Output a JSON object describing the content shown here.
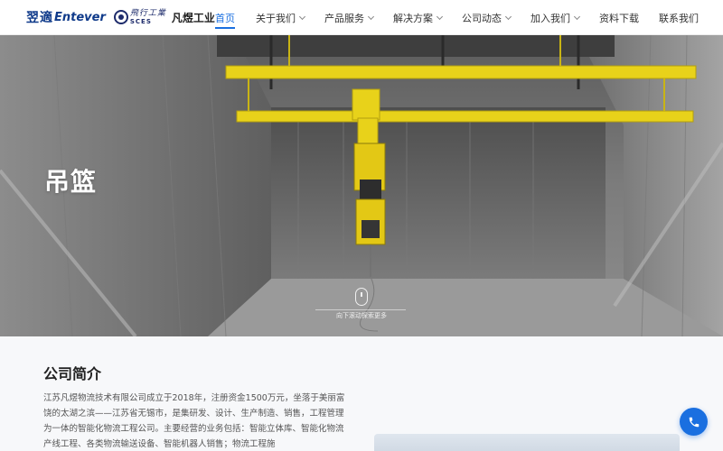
{
  "brand": {
    "logo_yt": "翌適",
    "logo_entever": "Entever",
    "logo_sces_cn": "飛行工業",
    "logo_sces_en": "SCES",
    "company_short": "凡煜工业"
  },
  "nav": {
    "items": [
      {
        "label": "首页",
        "active": true,
        "dropdown": false
      },
      {
        "label": "关于我们",
        "active": false,
        "dropdown": true
      },
      {
        "label": "产品服务",
        "active": false,
        "dropdown": true
      },
      {
        "label": "解决方案",
        "active": false,
        "dropdown": true
      },
      {
        "label": "公司动态",
        "active": false,
        "dropdown": true
      },
      {
        "label": "加入我们",
        "active": false,
        "dropdown": true
      },
      {
        "label": "资料下载",
        "active": false,
        "dropdown": false
      },
      {
        "label": "联系我们",
        "active": false,
        "dropdown": false
      }
    ]
  },
  "hero": {
    "title": "吊篮",
    "scroll_hint": "向下滚动探索更多"
  },
  "intro": {
    "title": "公司简介",
    "body": "江苏凡煜物流技术有限公司成立于2018年，注册资金1500万元，坐落于美丽富饶的太湖之滨——江苏省无锡市，是集研发、设计、生产制造、销售，工程管理为一体的智能化物流工程公司。主要经营的业务包括：智能立体库、智能化物流产线工程、各类物流输送设备、智能机器人销售；物流工程施"
  },
  "float_button": {
    "icon": "phone-icon"
  },
  "colors": {
    "accent": "#1a6fe0",
    "crane": "#e8d21a"
  }
}
